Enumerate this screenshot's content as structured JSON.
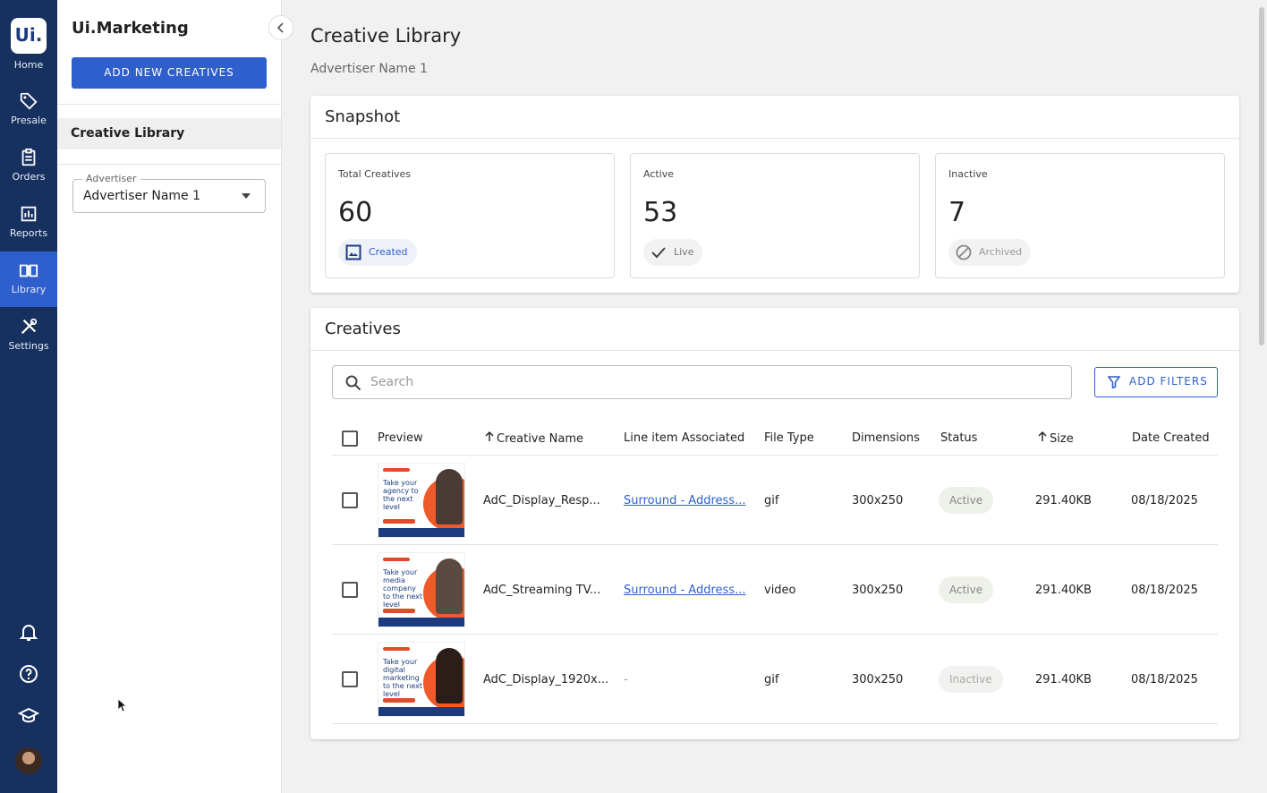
{
  "rail": {
    "logo": "Ui.",
    "home_label": "Home",
    "items": [
      {
        "label": "Presale",
        "icon": "tag-icon"
      },
      {
        "label": "Orders",
        "icon": "clipboard-icon"
      },
      {
        "label": "Reports",
        "icon": "chart-icon"
      },
      {
        "label": "Library",
        "icon": "book-icon",
        "active": true
      },
      {
        "label": "Settings",
        "icon": "tools-icon"
      }
    ],
    "bottom_icons": [
      "bell-icon",
      "help-icon",
      "graduation-cap-icon"
    ],
    "accent": "#2f5fcc",
    "background": "#16305f"
  },
  "sidebar": {
    "title": "Ui.Marketing",
    "add_button": "ADD NEW CREATIVES",
    "nav_item": "Creative Library",
    "advertiser_legend": "Advertiser",
    "advertiser_value": "Advertiser Name 1"
  },
  "main": {
    "title": "Creative Library",
    "subtitle": "Advertiser Name 1"
  },
  "snapshot": {
    "title": "Snapshot",
    "cards": [
      {
        "label": "Total Creatives",
        "value": "60",
        "chip": "Created",
        "chip_icon": "image-icon"
      },
      {
        "label": "Active",
        "value": "53",
        "chip": "Live",
        "chip_icon": "check-icon"
      },
      {
        "label": "Inactive",
        "value": "7",
        "chip": "Archived",
        "chip_icon": "blocked-icon"
      }
    ]
  },
  "creatives": {
    "title": "Creatives",
    "search_placeholder": "Search",
    "filters_button": "ADD FILTERS",
    "columns": [
      "Preview",
      "Creative Name",
      "Line item Associated",
      "File Type",
      "Dimensions",
      "Status",
      "Size",
      "Date Created"
    ],
    "rows": [
      {
        "thumb_text": "Take your agency to the next level",
        "name": "AdC_Display_Resp...",
        "line_item": "Surround - Address...",
        "file_type": "gif",
        "dimensions": "300x250",
        "status": "Active",
        "size": "291.40KB",
        "date": "08/18/2025"
      },
      {
        "thumb_text": "Take your media company to the next level",
        "name": "AdC_Streaming TV...",
        "line_item": "Surround - Address...",
        "file_type": "video",
        "dimensions": "300x250",
        "status": "Active",
        "size": "291.40KB",
        "date": "08/18/2025"
      },
      {
        "thumb_text": "Take your digital marketing to the next level",
        "name": "AdC_Display_1920x...",
        "line_item": "-",
        "file_type": "gif",
        "dimensions": "300x250",
        "status": "Inactive",
        "size": "291.40KB",
        "date": "08/18/2025"
      }
    ]
  }
}
